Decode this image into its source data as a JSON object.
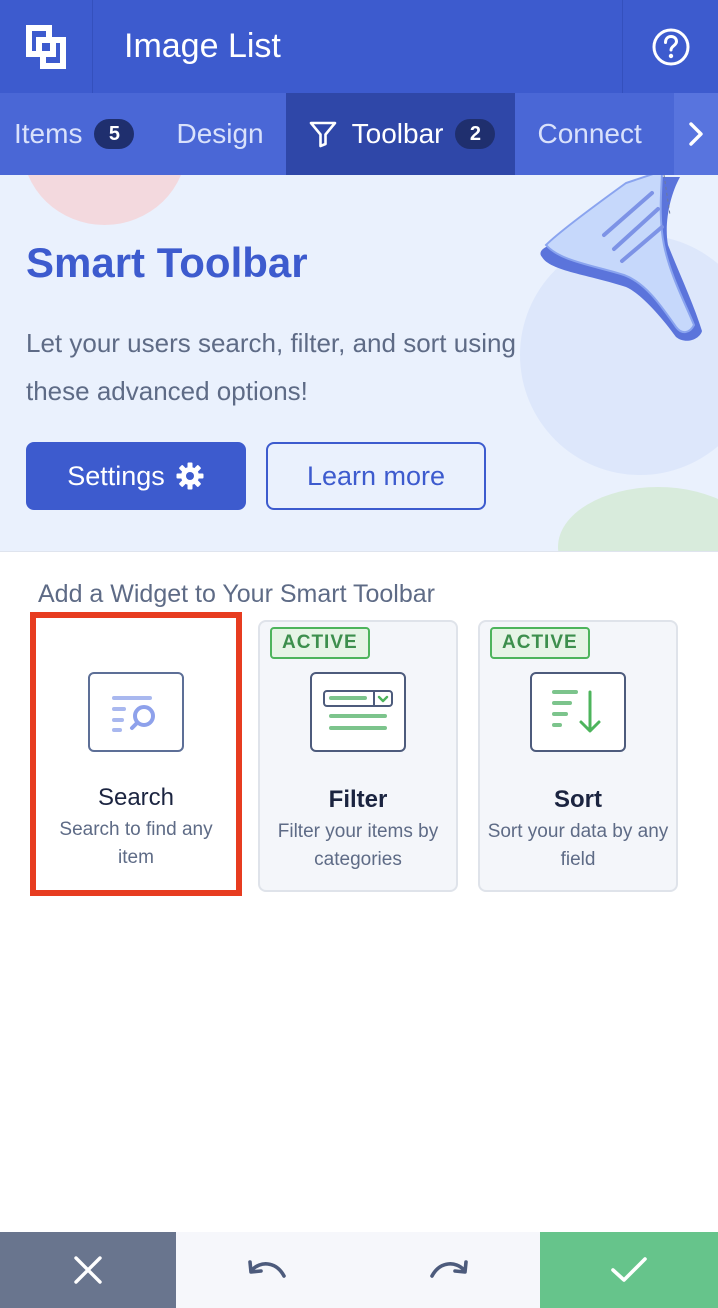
{
  "header": {
    "title": "Image List",
    "logo_icon": "app-logo-icon",
    "help_icon": "help-circle-icon"
  },
  "tabs": [
    {
      "label": "Items",
      "badge": "5"
    },
    {
      "label": "Design"
    },
    {
      "label": "Toolbar",
      "badge": "2",
      "active": true,
      "icon": "filter-icon"
    },
    {
      "label": "Connect"
    }
  ],
  "tabs_more_icon": "chevron-right-icon",
  "hero": {
    "title": "Smart Toolbar",
    "description": "Let your users search, filter, and sort using these advanced options!",
    "settings_label": "Settings",
    "settings_icon": "gear-icon",
    "learn_more_label": "Learn more"
  },
  "widgets_section": {
    "title": "Add a Widget to Your Smart Toolbar",
    "widgets": [
      {
        "name": "Search",
        "description": "Search to find any item",
        "badge": "",
        "icon": "search-list-icon",
        "selected": true
      },
      {
        "name": "Filter",
        "description": "Filter your items by categories",
        "badge": "ACTIVE",
        "icon": "filter-list-icon"
      },
      {
        "name": "Sort",
        "description": "Sort your data by any field",
        "badge": "ACTIVE",
        "icon": "sort-list-icon"
      }
    ]
  },
  "bottom_bar": {
    "close_icon": "close-icon",
    "undo_icon": "undo-icon",
    "redo_icon": "redo-icon",
    "confirm_icon": "checkmark-icon"
  },
  "colors": {
    "brand": "#3d5bce",
    "tab_active": "#2f47a8",
    "selection": "#e73c20",
    "active_badge": "#4db45c",
    "confirm": "#66c48b",
    "close": "#69758e"
  }
}
